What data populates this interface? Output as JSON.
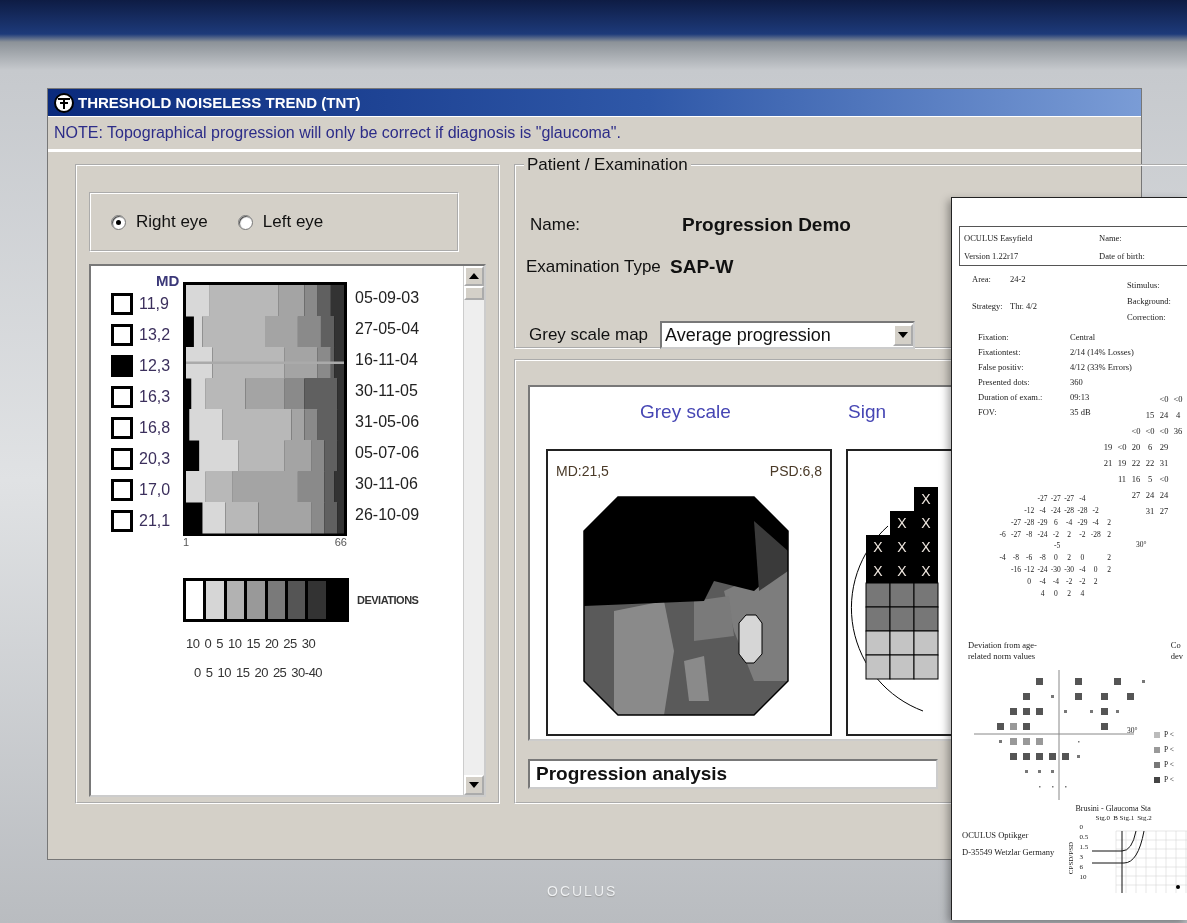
{
  "window": {
    "title": "THRESHOLD NOISELESS TREND (TNT)"
  },
  "note": "NOTE: Topographical progression will only be correct if diagnosis is \"glaucoma\".",
  "eye_options": [
    {
      "label": "Right eye",
      "selected": true
    },
    {
      "label": "Left eye",
      "selected": false
    }
  ],
  "trend": {
    "md_header": "MD",
    "rows": [
      {
        "checked": false,
        "md": "11,9",
        "date": "05-09-03"
      },
      {
        "checked": false,
        "md": "13,2",
        "date": "27-05-04"
      },
      {
        "checked": true,
        "md": "12,3",
        "date": "16-11-04"
      },
      {
        "checked": false,
        "md": "16,3",
        "date": "30-11-05"
      },
      {
        "checked": false,
        "md": "16,8",
        "date": "31-05-06"
      },
      {
        "checked": false,
        "md": "20,3",
        "date": "05-07-06"
      },
      {
        "checked": false,
        "md": "17,0",
        "date": "30-11-06"
      },
      {
        "checked": false,
        "md": "21,1",
        "date": "26-10-09"
      }
    ],
    "axis_start": "1",
    "axis_end": "66",
    "legend_title": "DEVIATIONS",
    "scale_1": [
      "10",
      "0",
      "5",
      "10",
      "15",
      "20",
      "25",
      "30"
    ],
    "scale_2": [
      "0",
      "5",
      "10",
      "15",
      "20",
      "25",
      "30-40"
    ]
  },
  "patient": {
    "group_title": "Patient / Examination",
    "name_label": "Name:",
    "name": "Progression Demo",
    "type_label": "Examination Type",
    "type": "SAP-W",
    "map_label": "Grey scale map",
    "map_value": "Average progression"
  },
  "analysis": {
    "grey_scale_title": "Grey scale",
    "md": "MD:21,5",
    "psd": "PSD:6,8",
    "significance_title": "Sign",
    "significance_marks": [
      "X",
      "X",
      "X",
      "X",
      "X",
      "X",
      "X",
      "X",
      "X"
    ],
    "progression_label": "Progression analysis"
  },
  "printout": {
    "product": "OCULUS Easyfield",
    "version": "Version 1.22r17",
    "name_label": "Name:",
    "dob_label": "Date of birth:",
    "params": [
      {
        "label": "Area:",
        "value": "24-2"
      },
      {
        "label": "Strategy:",
        "value": "Thr. 4/2"
      }
    ],
    "stimulus_labels": [
      "Stimulus:",
      "Background:",
      "Correction:"
    ],
    "stats": [
      {
        "label": "Fixation:",
        "value": "Central"
      },
      {
        "label": "Fixationtest:",
        "value": "2/14 (14% Losses)"
      },
      {
        "label": "False positiv:",
        "value": "4/12 (33% Errors)"
      },
      {
        "label": "Presented dots:",
        "value": "360"
      },
      {
        "label": "Duration of exam.:",
        "value": "09:13"
      },
      {
        "label": "FOV:",
        "value": "35 dB"
      }
    ],
    "threshold_rows": [
      [
        null,
        null,
        null,
        null,
        "<0",
        "<0"
      ],
      [
        null,
        null,
        null,
        "15",
        "24",
        "4"
      ],
      [
        null,
        null,
        "<0",
        "<0",
        "<0",
        "36"
      ],
      [
        "19",
        "<0",
        "20",
        "6",
        "29",
        null
      ],
      [
        "21",
        "19",
        "22",
        "22",
        "31",
        null
      ],
      [
        null,
        "11",
        "16",
        "5",
        "<0",
        null
      ],
      [
        null,
        null,
        "27",
        "24",
        "24",
        null
      ],
      [
        null,
        null,
        null,
        "31",
        "27",
        null
      ]
    ],
    "deviation_rows": [
      [
        null,
        null,
        null,
        "-27",
        "-27",
        "-27",
        "-4",
        null,
        null
      ],
      [
        null,
        null,
        "-12",
        "-4",
        "-24",
        "-28",
        "-28",
        "-2",
        null
      ],
      [
        null,
        "-27",
        "-28",
        "-29",
        "6",
        "-4",
        "-29",
        "-4",
        "2"
      ],
      [
        "-6",
        "-27",
        "-8",
        "-24",
        "-2",
        "2",
        "-2",
        "-28",
        "2"
      ],
      [
        "-4",
        "-8",
        "-6",
        "-8",
        "0",
        "2",
        "0",
        null,
        "2"
      ],
      [
        null,
        "-16",
        "-12",
        "-24",
        "-30",
        "-30",
        "-4",
        "0",
        "2"
      ],
      [
        null,
        null,
        "0",
        "-4",
        "-4",
        "-2",
        "-2",
        "2",
        null
      ],
      [
        null,
        null,
        null,
        "4",
        "0",
        "2",
        "4",
        null,
        null
      ]
    ],
    "deviation_center": "-5",
    "deviation_axis": "30°",
    "deviation_caption": "Deviation from age-related norm values",
    "corrected_caption": [
      "Co",
      "dev"
    ],
    "probability_axis": "30°",
    "probability_legend": [
      "P <",
      "P <",
      "P <",
      "P <"
    ],
    "brusini": {
      "title": "Brusini - Glaucoma Sta",
      "stages": [
        "Stg.0",
        "B Stg.1",
        "Stg.2"
      ],
      "ylabel": "CPSD/PSD",
      "yticks": [
        "0",
        "0.5",
        "1.5",
        "3",
        "6",
        "10"
      ]
    },
    "address": [
      "OCULUS Optikger",
      "D-35549 Wetzlar Germany"
    ]
  },
  "bezel_logo": "OCULUS"
}
